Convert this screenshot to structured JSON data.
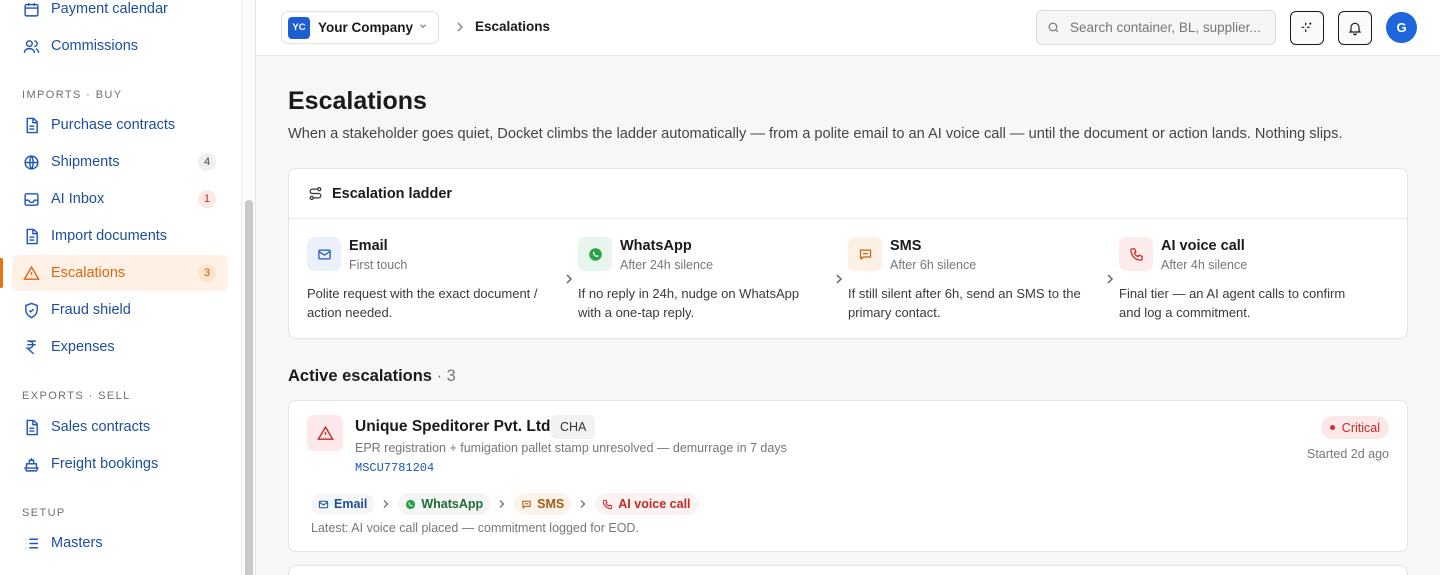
{
  "sidebar": {
    "top_items": [
      {
        "label": "Payment calendar",
        "icon": "calendar-icon"
      },
      {
        "label": "Commissions",
        "icon": "users-icon"
      }
    ],
    "sections": [
      {
        "label": "IMPORTS · BUY",
        "items": [
          {
            "label": "Purchase contracts",
            "icon": "document-icon"
          },
          {
            "label": "Shipments",
            "icon": "globe-icon",
            "badge": "4"
          },
          {
            "label": "AI Inbox",
            "icon": "inbox-icon",
            "badge": "1"
          },
          {
            "label": "Import documents",
            "icon": "document-icon"
          },
          {
            "label": "Escalations",
            "icon": "warning-icon",
            "badge": "3",
            "active": true
          },
          {
            "label": "Fraud shield",
            "icon": "shield-icon"
          },
          {
            "label": "Expenses",
            "icon": "rupee-icon"
          }
        ]
      },
      {
        "label": "EXPORTS · SELL",
        "items": [
          {
            "label": "Sales contracts",
            "icon": "document-icon"
          },
          {
            "label": "Freight bookings",
            "icon": "ship-icon"
          }
        ]
      },
      {
        "label": "SETUP",
        "items": [
          {
            "label": "Masters",
            "icon": "list-icon"
          }
        ]
      }
    ]
  },
  "topbar": {
    "company_initials": "YC",
    "company_name": "Your Company",
    "breadcrumb": "Escalations",
    "search_placeholder": "Search container, BL, supplier...",
    "avatar_initial": "G"
  },
  "page": {
    "title": "Escalations",
    "description": "When a stakeholder goes quiet, Docket climbs the ladder automatically — from a polite email to an AI voice call — until the document or action lands. Nothing slips."
  },
  "ladder": {
    "title": "Escalation ladder",
    "steps": [
      {
        "name": "Email",
        "sub": "First touch",
        "desc": "Polite request with the exact document / action needed.",
        "icon": "mail-icon",
        "color": "#1d55b8",
        "bg": "#eaf1fb"
      },
      {
        "name": "WhatsApp",
        "sub": "After 24h silence",
        "desc": "If no reply in 24h, nudge on WhatsApp with a one-tap reply.",
        "icon": "whatsapp-icon",
        "color": "#ffffff",
        "bg": "#e8f5ec"
      },
      {
        "name": "SMS",
        "sub": "After 6h silence",
        "desc": "If still silent after 6h, send an SMS to the primary contact.",
        "icon": "sms-icon",
        "color": "#c2620f",
        "bg": "#fdf0e4"
      },
      {
        "name": "AI voice call",
        "sub": "After 4h silence",
        "desc": "Final tier — an AI agent calls to confirm and log a commitment.",
        "icon": "phone-icon",
        "color": "#c62828",
        "bg": "#fdecec"
      }
    ]
  },
  "active": {
    "title": "Active escalations",
    "count": "· 3",
    "items": [
      {
        "company": "Unique Speditorer Pvt. Ltd.",
        "tag": "CHA",
        "desc": "EPR registration + fumigation pallet stamp unresolved — demurrage in 7 days",
        "ref": "MSCU7781204",
        "severity": "Critical",
        "started": "Started 2d ago",
        "chips": [
          "Email",
          "WhatsApp",
          "SMS",
          "AI voice call"
        ],
        "latest": "Latest: AI voice call placed — commitment logged for EOD."
      }
    ]
  }
}
